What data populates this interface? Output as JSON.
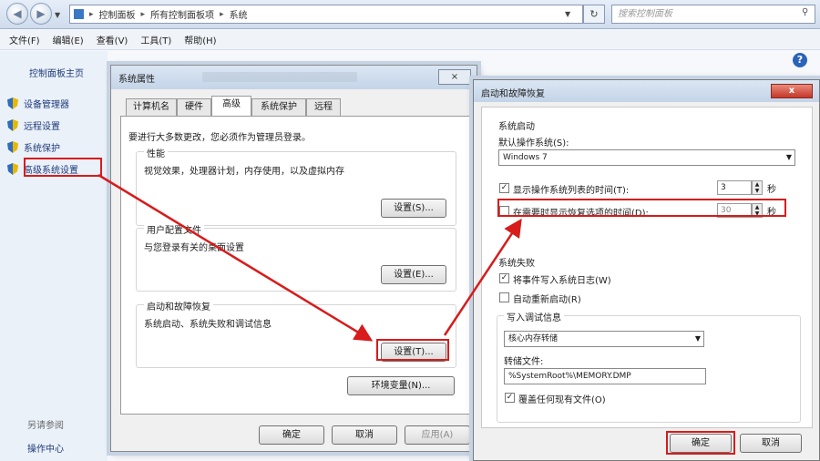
{
  "addressbar": {
    "breadcrumb": [
      "控制面板",
      "所有控制面板项",
      "系统"
    ],
    "search_placeholder": "搜索控制面板"
  },
  "menubar": [
    "文件(F)",
    "编辑(E)",
    "查看(V)",
    "工具(T)",
    "帮助(H)"
  ],
  "leftpane": {
    "home": "控制面板主页",
    "items": [
      "设备管理器",
      "远程设置",
      "系统保护",
      "高级系统设置"
    ],
    "see_also": "另请参阅",
    "action_center": "操作中心"
  },
  "system_properties": {
    "title": "系统属性",
    "close": "×",
    "tabs": [
      "计算机名",
      "硬件",
      "高级",
      "系统保护",
      "远程"
    ],
    "active_tab": "高级",
    "admin_note": "要进行大多数更改，您必须作为管理员登录。",
    "performance": {
      "title": "性能",
      "desc": "视觉效果，处理器计划，内存使用，以及虚拟内存",
      "button": "设置(S)..."
    },
    "user_profiles": {
      "title": "用户配置文件",
      "desc": "与您登录有关的桌面设置",
      "button": "设置(E)..."
    },
    "startup_recovery": {
      "title": "启动和故障恢复",
      "desc": "系统启动、系统失败和调试信息",
      "button": "设置(T)..."
    },
    "env_button": "环境变量(N)...",
    "ok": "确定",
    "cancel": "取消",
    "apply": "应用(A)"
  },
  "startup_recovery_dialog": {
    "title": "启动和故障恢复",
    "close": "x",
    "system_startup": "系统启动",
    "default_os_label": "默认操作系统(S):",
    "default_os_value": "Windows 7",
    "show_os_list": {
      "label": "显示操作系统列表的时间(T):",
      "checked": true,
      "value": "3",
      "unit": "秒"
    },
    "show_recovery": {
      "label": "在需要时显示恢复选项的时间(D):",
      "checked": false,
      "value": "30",
      "unit": "秒"
    },
    "system_failure": "系统失败",
    "write_event": {
      "label": "将事件写入系统日志(W)",
      "checked": true
    },
    "auto_restart": {
      "label": "自动重新启动(R)",
      "checked": false
    },
    "debug_info": "写入调试信息",
    "debug_value": "核心内存转储",
    "dump_file_label": "转储文件:",
    "dump_file_value": "%SystemRoot%\\MEMORY.DMP",
    "overwrite": {
      "label": "覆盖任何现有文件(O)",
      "checked": true
    },
    "ok": "确定",
    "cancel": "取消"
  },
  "colors": {
    "highlight": "#d81b1b",
    "link": "#1f3a7a"
  }
}
